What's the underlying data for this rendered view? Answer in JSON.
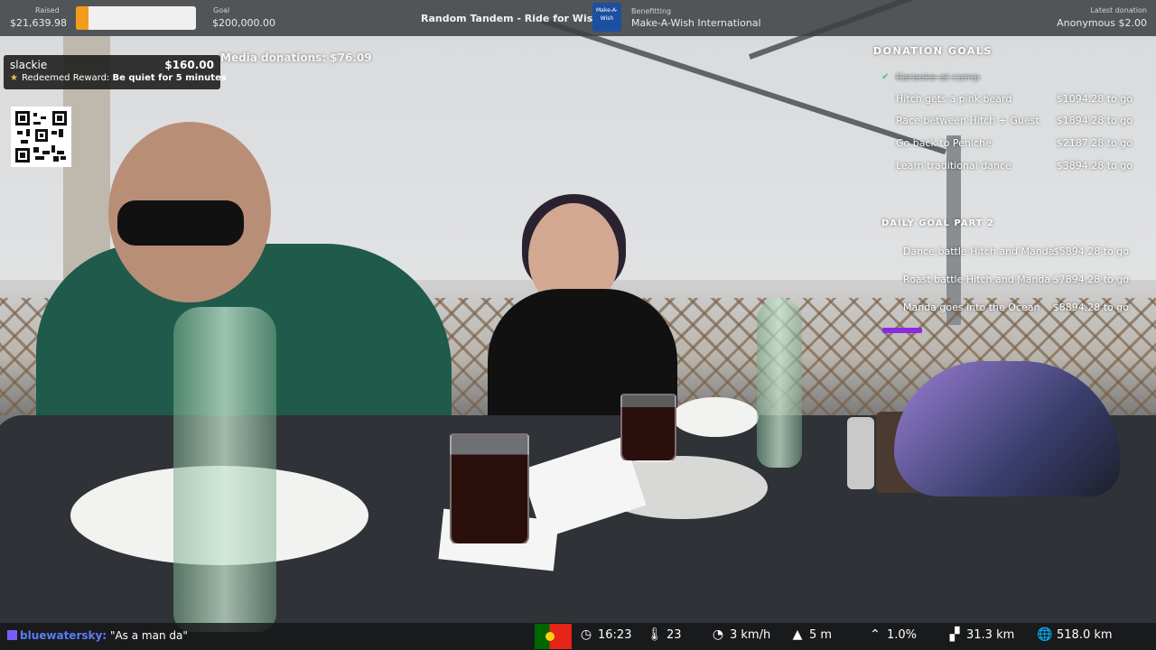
{
  "topbar": {
    "raised_label": "Raised",
    "raised_value": "$21,639.98",
    "progress_fraction": 0.108,
    "goal_label": "Goal",
    "goal_value": "$200,000.00",
    "title": "Random Tandem - Ride for Wishes",
    "charity_logo_text": "Make-A-Wish",
    "benefitting_label": "Benefitting",
    "benefitting_value": "Make-A-Wish International",
    "latest_label": "Latest donation",
    "latest_value": "Anonymous $2.00",
    "colors": {
      "progress": "#f39c1c",
      "bar_bg": "#3c3e42"
    }
  },
  "reward": {
    "user": "slackie",
    "amount": "$160.00",
    "prefix": "Redeemed Reward:",
    "text": "Be quiet for 5 minutes",
    "icon": "star-icon"
  },
  "media_donations": "Media donations: $76.09",
  "donation_goals": {
    "title": "DONATION GOALS",
    "items": [
      {
        "label": "Karaoke at camp",
        "amount": "",
        "completed": true
      },
      {
        "label": "Hitch gets a pink beard",
        "amount": "$1094.28 to go"
      },
      {
        "label": "Race between Hitch + Guest",
        "amount": "$1894.28 to go"
      },
      {
        "label": "Go back to Peniche",
        "amount": "$2187.28 to go"
      },
      {
        "label": "Learn traditional dance",
        "amount": "$3894.28 to go"
      }
    ]
  },
  "daily_goal": {
    "title": "DAILY GOAL PART 2",
    "items": [
      {
        "label": "Dance battle Hitch and Manda",
        "amount": "$5894.28 to go"
      },
      {
        "label": "Roast battle Hitch and Manda",
        "amount": "$7894.28 to go"
      },
      {
        "label": "Manda goes into the Ocean",
        "amount": "$8894.28 to go"
      }
    ],
    "accent": "#8a2be2"
  },
  "chat": {
    "username": "bluewatersky:",
    "message": "\"As a man da\""
  },
  "stats": {
    "country_flag": "portugal-flag",
    "time": "16:23",
    "temperature": "23",
    "speed": "3 km/h",
    "altitude": "5 m",
    "incline": "1.0%",
    "distance": "31.3 km",
    "total_distance": "518.0 km"
  }
}
